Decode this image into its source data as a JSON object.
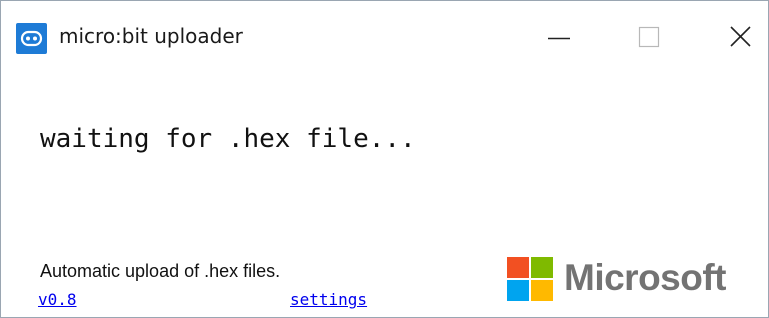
{
  "window": {
    "title": "micro:bit uploader",
    "icon": "microbit-app-icon",
    "controls": {
      "minimize_icon": "minimize-icon",
      "maximize_icon": "maximize-icon",
      "close_icon": "close-icon"
    }
  },
  "main": {
    "status_text": "waiting for .hex file..."
  },
  "footer": {
    "description": "Automatic upload of .hex files.",
    "version_link": "v0.8",
    "settings_link": "settings",
    "brand": {
      "wordmark": "Microsoft",
      "colors": {
        "red": "#f25022",
        "green": "#7fba00",
        "blue": "#00a4ef",
        "yellow": "#ffb900"
      }
    }
  },
  "colors": {
    "link": "#0000ee",
    "accent": "#1e7bd6"
  }
}
